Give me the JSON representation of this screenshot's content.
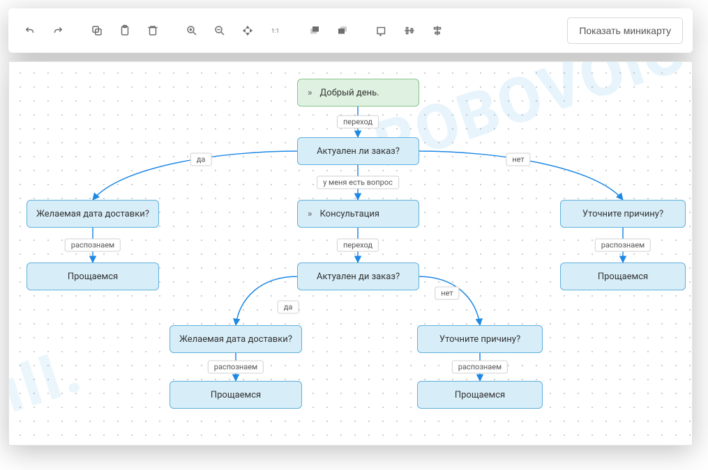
{
  "toolbar": {
    "minimap_label": "Показать миникарту"
  },
  "watermark": "ROBOVOICE",
  "nodes": {
    "start": {
      "label": "Добрый день."
    },
    "q_actual": {
      "label": "Актуален ли заказ?"
    },
    "consult": {
      "label": "Консультация"
    },
    "q_actual2": {
      "label": "Актуален ди заказ?"
    },
    "date_l": {
      "label": "Желаемая дата доставки?"
    },
    "bye_l": {
      "label": "Прощаемся"
    },
    "reason_r": {
      "label": "Уточните причину?"
    },
    "bye_r": {
      "label": "Прощаемся"
    },
    "date_c": {
      "label": "Желаемая дата доставки?"
    },
    "bye_cl": {
      "label": "Прощаемся"
    },
    "reason_c": {
      "label": "Уточните причину?"
    },
    "bye_cr": {
      "label": "Прощаемся"
    }
  },
  "edges": {
    "e1": "переход",
    "e2": "у меня есть вопрос",
    "e3": "переход",
    "yes": "да",
    "no": "нет",
    "rec": "распознаем"
  }
}
